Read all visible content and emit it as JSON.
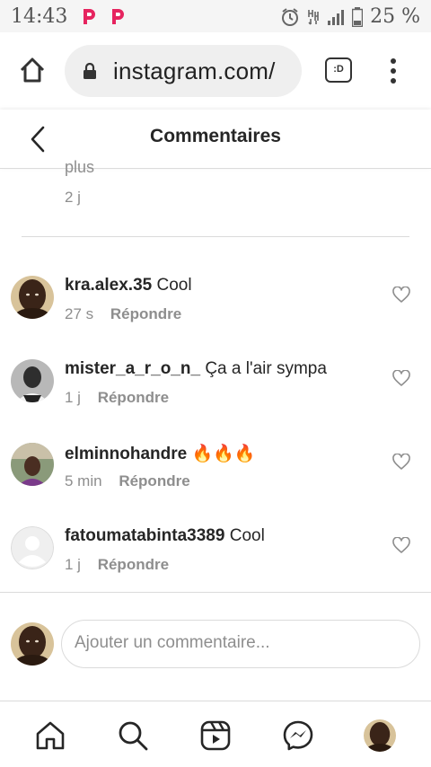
{
  "status_bar": {
    "time": "14:43",
    "battery": "25 %",
    "icons": [
      "pocket-casts-icon",
      "pocket-casts-icon",
      "alarm-icon",
      "network-type-icon",
      "signal-icon",
      "battery-icon"
    ]
  },
  "browser": {
    "url": "instagram.com/",
    "tab_label": ":D"
  },
  "header": {
    "title": "Commentaires"
  },
  "previous_comment": {
    "more_text": "plus",
    "time": "2 j"
  },
  "comments": [
    {
      "username": "kra.alex.35",
      "text": "Cool",
      "time": "27 s",
      "reply": "Répondre"
    },
    {
      "username": "mister_a_r_o_n_",
      "text": "Ça a l'air sympa",
      "time": "1 j",
      "reply": "Répondre"
    },
    {
      "username": "elminnohandre",
      "text": "🔥🔥🔥",
      "time": "5 min",
      "reply": "Répondre"
    },
    {
      "username": "fatoumatabinta3389",
      "text": "Cool",
      "time": "1 j",
      "reply": "Répondre"
    }
  ],
  "compose": {
    "placeholder": "Ajouter un commentaire..."
  },
  "nav": [
    "home-icon",
    "search-icon",
    "reels-icon",
    "messenger-icon",
    "profile-avatar"
  ],
  "colors": {
    "text": "#262626",
    "muted": "#8e8e8e",
    "divider": "#dbdbdb",
    "urlbar": "#efefef"
  }
}
